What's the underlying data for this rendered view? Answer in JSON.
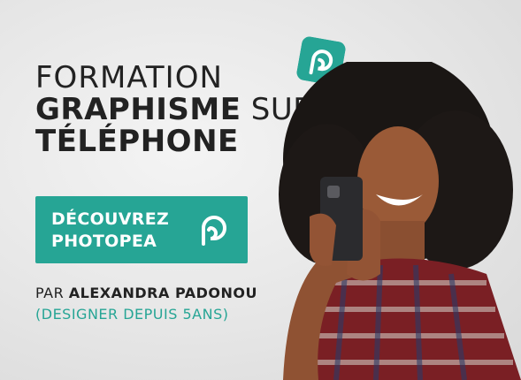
{
  "title": {
    "line1": "FORMATION",
    "line2_bold": "GRAPHISME",
    "line2_light": " SUR",
    "line3": "TÉLÉPHONE"
  },
  "cta": {
    "line1": "DÉCOUVREZ",
    "line2": "PHOTOPEA",
    "icon": "photopea-logo-icon"
  },
  "byline": {
    "prefix": "PAR ",
    "name": "ALEXANDRA PADONOU",
    "since": "(DESIGNER DEPUIS 5ANS)"
  },
  "colors": {
    "accent": "#26a595",
    "text": "#222222",
    "background": "#e6e6e6"
  }
}
